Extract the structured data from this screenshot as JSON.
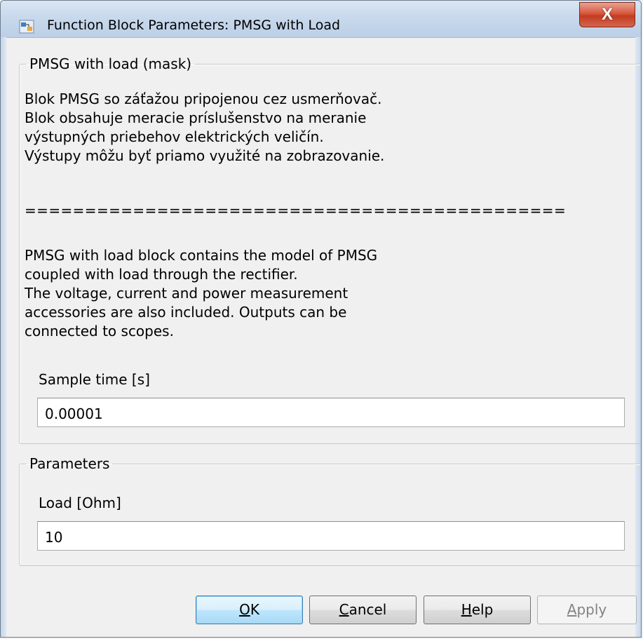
{
  "window": {
    "title": "Function Block Parameters: PMSG with Load",
    "close_label": "X"
  },
  "mask": {
    "legend": "PMSG with load (mask)",
    "description_sk": "Blok PMSG so záťažou pripojenou cez usmerňovač.\nBlok obsahuje meracie príslušenstvo na meranie\nvýstupných priebehov elektrických veličín.\nVýstupy môžu byť priamo využité na zobrazovanie.",
    "separator": "=============================================",
    "description_en": "PMSG with load block contains the model of PMSG\ncoupled with load through the rectifier.\nThe voltage, current and power measurement\naccessories are also included. Outputs can be\nconnected to scopes.",
    "sample_time_label": "Sample time [s]",
    "sample_time_value": "0.00001"
  },
  "parameters": {
    "legend": "Parameters",
    "load_label": "Load [Ohm]",
    "load_value": "10"
  },
  "buttons": {
    "ok_mnemonic": "O",
    "ok_rest": "K",
    "cancel_mnemonic": "C",
    "cancel_rest": "ancel",
    "help_mnemonic": "H",
    "help_rest": "elp",
    "apply_mnemonic": "A",
    "apply_rest": "pply"
  }
}
